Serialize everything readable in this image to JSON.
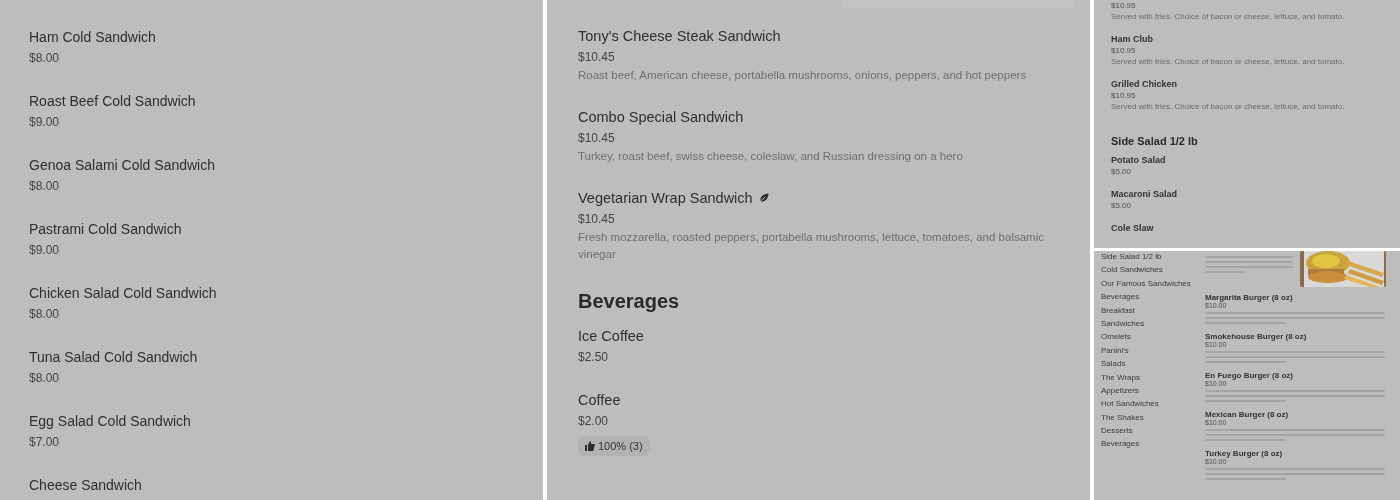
{
  "left_panel": {
    "items": [
      {
        "name": "Ham Cold Sandwich",
        "price": "$8.00"
      },
      {
        "name": "Roast Beef Cold Sandwich",
        "price": "$9.00"
      },
      {
        "name": "Genoa Salami Cold Sandwich",
        "price": "$8.00"
      },
      {
        "name": "Pastrami Cold Sandwich",
        "price": "$9.00"
      },
      {
        "name": "Chicken Salad Cold Sandwich",
        "price": "$8.00"
      },
      {
        "name": "Tuna Salad Cold Sandwich",
        "price": "$8.00"
      },
      {
        "name": "Egg Salad Cold Sandwich",
        "price": "$7.00"
      },
      {
        "name": "Cheese Sandwich"
      }
    ]
  },
  "middle_panel": {
    "sections": [
      {
        "items": [
          {
            "name": "Tony's Cheese Steak Sandwich",
            "price": "$10.45",
            "description": "Roast beef, American cheese, portabella mushrooms, onions, peppers, and hot peppers",
            "vegetarian": false
          },
          {
            "name": "Combo Special Sandwich",
            "price": "$10.45",
            "description": "Turkey, roast beef, swiss cheese, coleslaw, and Russian dressing on a hero",
            "vegetarian": false
          },
          {
            "name": "Vegetarian Wrap Sandwich",
            "price": "$10.45",
            "description": "Fresh mozzarella, roasted peppers, portabella mushrooms, lettuce, tomatoes, and balsamic vinegar",
            "vegetarian": true
          }
        ]
      },
      {
        "heading": "Beverages",
        "items": [
          {
            "name": "Ice Coffee",
            "price": "$2.50",
            "vegetarian": false
          },
          {
            "name": "Coffee",
            "price": "$2.00",
            "rating": "100% (3)",
            "vegetarian": false
          }
        ]
      }
    ]
  },
  "right_top_panel": {
    "sections": [
      {
        "items": [
          {
            "price": "$10.95",
            "description": "Served with fries. Choice of bacon or cheese, lettuce, and tomato."
          },
          {
            "name": "Ham Club",
            "price": "$10.95",
            "description": "Served with fries. Choice of bacon or cheese, lettuce, and tomato."
          },
          {
            "name": "Grilled Chicken",
            "price": "$10.95",
            "description": "Served with fries. Choice of bacon or cheese, lettuce, and tomato."
          }
        ]
      },
      {
        "heading": "Side Salad 1/2 lb",
        "items": [
          {
            "name": "Potato Salad",
            "price": "$5.00"
          },
          {
            "name": "Macaroni Salad",
            "price": "$5.00"
          },
          {
            "name": "Cole Slaw"
          }
        ]
      }
    ]
  },
  "right_bottom_panel": {
    "categories": [
      "Side Salad 1/2 lb",
      "Cold Sandwiches",
      "Our Famous Sandwiches",
      "Beverages",
      "Breakfast",
      "Sandwiches",
      "Omelets",
      "Panini's",
      "Salads",
      "The Wraps",
      "Appetizers",
      "Hot Sandwiches",
      "The Shakes",
      "Desserts",
      "Beverages"
    ],
    "items": [
      {
        "has_description": true
      },
      {
        "name": "Margarita Burger (8 oz)",
        "price": "$10.00",
        "has_description": true
      },
      {
        "name": "Smokehouse Burger (8 oz)",
        "price": "$10.00",
        "has_description": true
      },
      {
        "name": "En Fuego Burger (8 oz)",
        "price": "$10.00",
        "has_description": true
      },
      {
        "name": "Mexican Burger (8 oz)",
        "price": "$10.00",
        "has_description": true
      },
      {
        "name": "Turkey Burger (8 oz)",
        "price": "$10.00",
        "has_description": true
      }
    ]
  }
}
